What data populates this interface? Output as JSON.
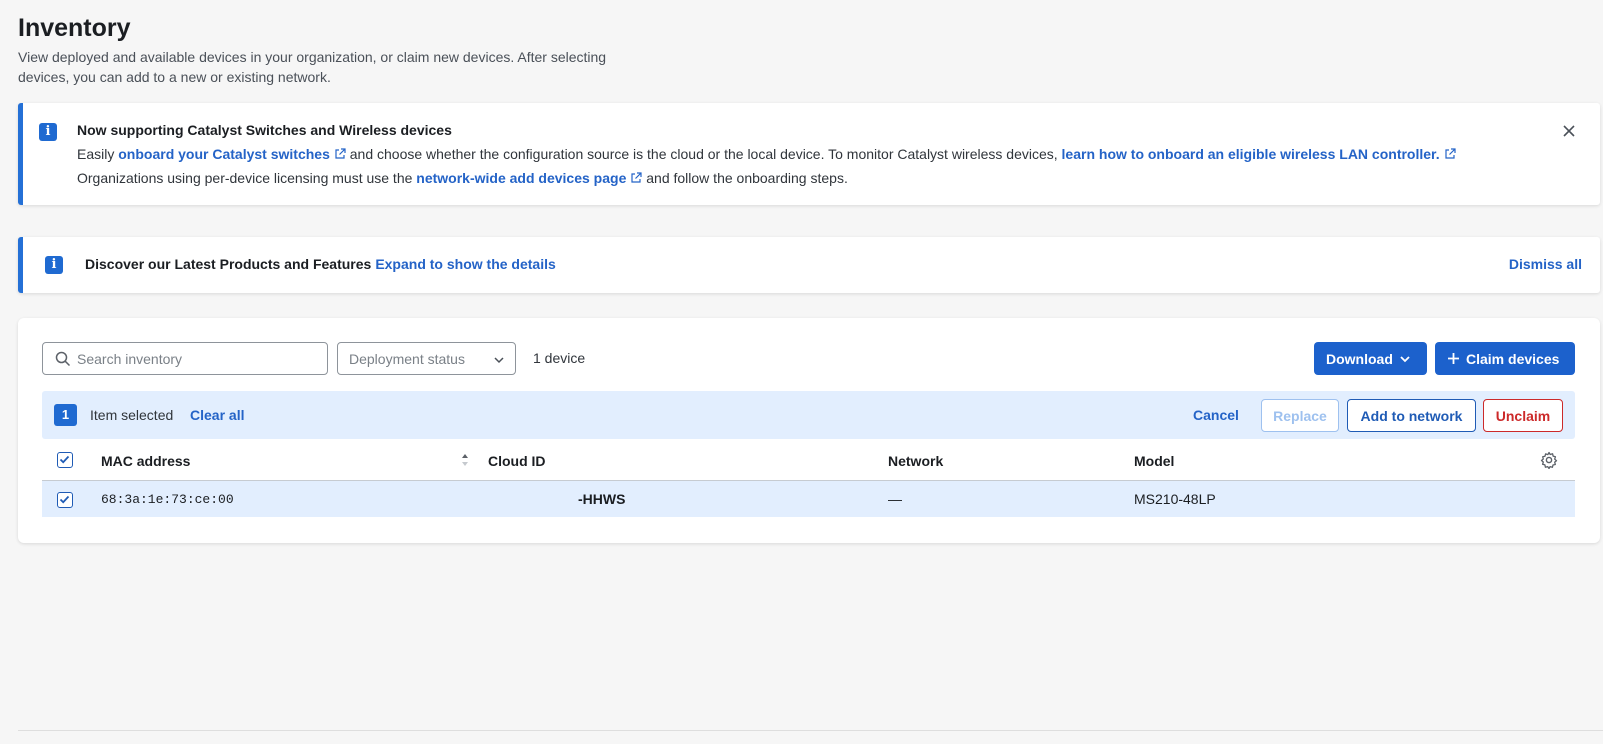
{
  "page": {
    "title": "Inventory",
    "description": "View deployed and available devices in your organization, or claim new devices. After selecting devices, you can add to a new or existing network."
  },
  "banner_catalyst": {
    "title": "Now supporting Catalyst Switches and Wireless devices",
    "line1_prefix": "Easily",
    "link_switches": "onboard your Catalyst switches",
    "line1_middle": "and choose whether the configuration source is the cloud or the local device. To monitor Catalyst wireless devices,",
    "link_wlc": "learn how to onboard an eligible wireless LAN controller.",
    "line2_prefix": "Organizations using per-device licensing must use the",
    "link_add_devices": "network-wide add devices page",
    "line2_suffix": "and follow the onboarding steps."
  },
  "banner_products": {
    "title": "Discover our Latest Products and Features",
    "expand_link": "Expand to show the details",
    "dismiss_all": "Dismiss all"
  },
  "toolbar": {
    "search_placeholder": "Search inventory",
    "deployment_status": "Deployment status",
    "device_count": "1 device",
    "download_label": "Download",
    "claim_label": "Claim devices"
  },
  "selection": {
    "count": "1",
    "text": "Item selected",
    "clear_all": "Clear all",
    "cancel": "Cancel",
    "replace": "Replace",
    "add_to_network": "Add to network",
    "unclaim": "Unclaim"
  },
  "table": {
    "columns": [
      "MAC address",
      "Cloud ID",
      "Network",
      "Model"
    ],
    "rows": [
      {
        "mac": "68:3a:1e:73:ce:00",
        "cloud_id": "-HHWS",
        "network": "—",
        "model": "MS210-48LP",
        "selected": true
      }
    ]
  },
  "colors": {
    "accent": "#1c61cc",
    "selection_bg": "#e2eefe",
    "danger": "#cc2a2a"
  }
}
